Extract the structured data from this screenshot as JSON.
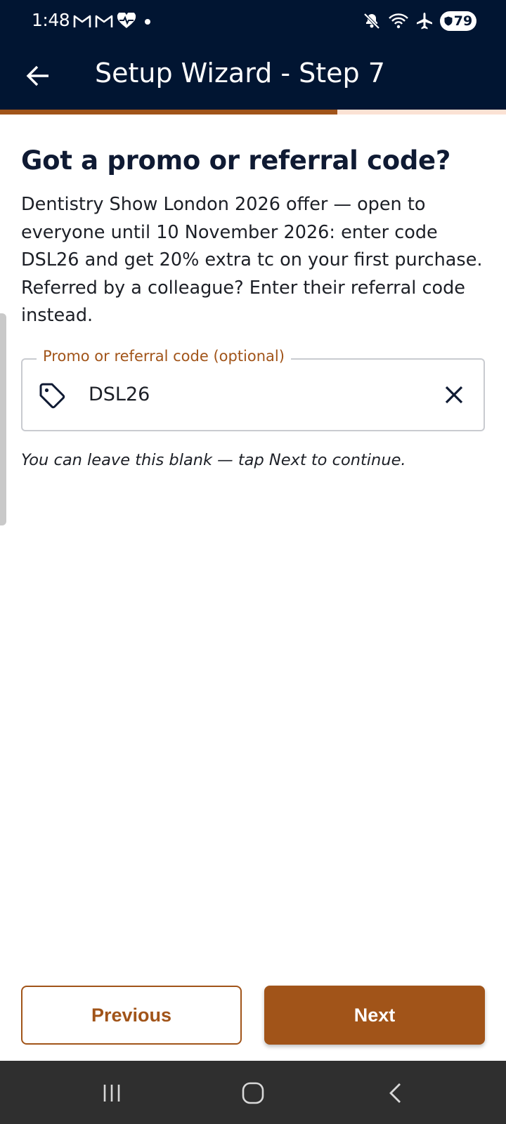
{
  "status_bar": {
    "time": "1:48",
    "battery_level": "79",
    "notification_icons": [
      "gmail-icon",
      "gmail-icon",
      "health-icon",
      "dot-icon"
    ],
    "system_icons": [
      "mute-icon",
      "wifi-icon",
      "airplane-icon",
      "battery-icon"
    ]
  },
  "app_bar": {
    "title": "Setup Wizard - Step 7",
    "back_icon": "arrow-left-icon"
  },
  "progress": {
    "fraction": 0.6667
  },
  "content": {
    "heading": "Got a promo or referral code?",
    "description": "Dentistry Show London 2026 offer — open to everyone until 10 November 2026: enter code DSL26 and get 20% extra tc on your first purchase. Referred by a colleague? Enter their referral code instead.",
    "field": {
      "label": "Promo or referral code (optional)",
      "value": "DSL26",
      "leading_icon": "tag-icon",
      "trailing_icon": "close-icon"
    },
    "hint": "You can leave this blank — tap Next to continue."
  },
  "actions": {
    "previous_label": "Previous",
    "next_label": "Next"
  },
  "colors": {
    "header_bg": "#011532",
    "accent": "#a15419",
    "progress_track": "#fbe2d4"
  }
}
